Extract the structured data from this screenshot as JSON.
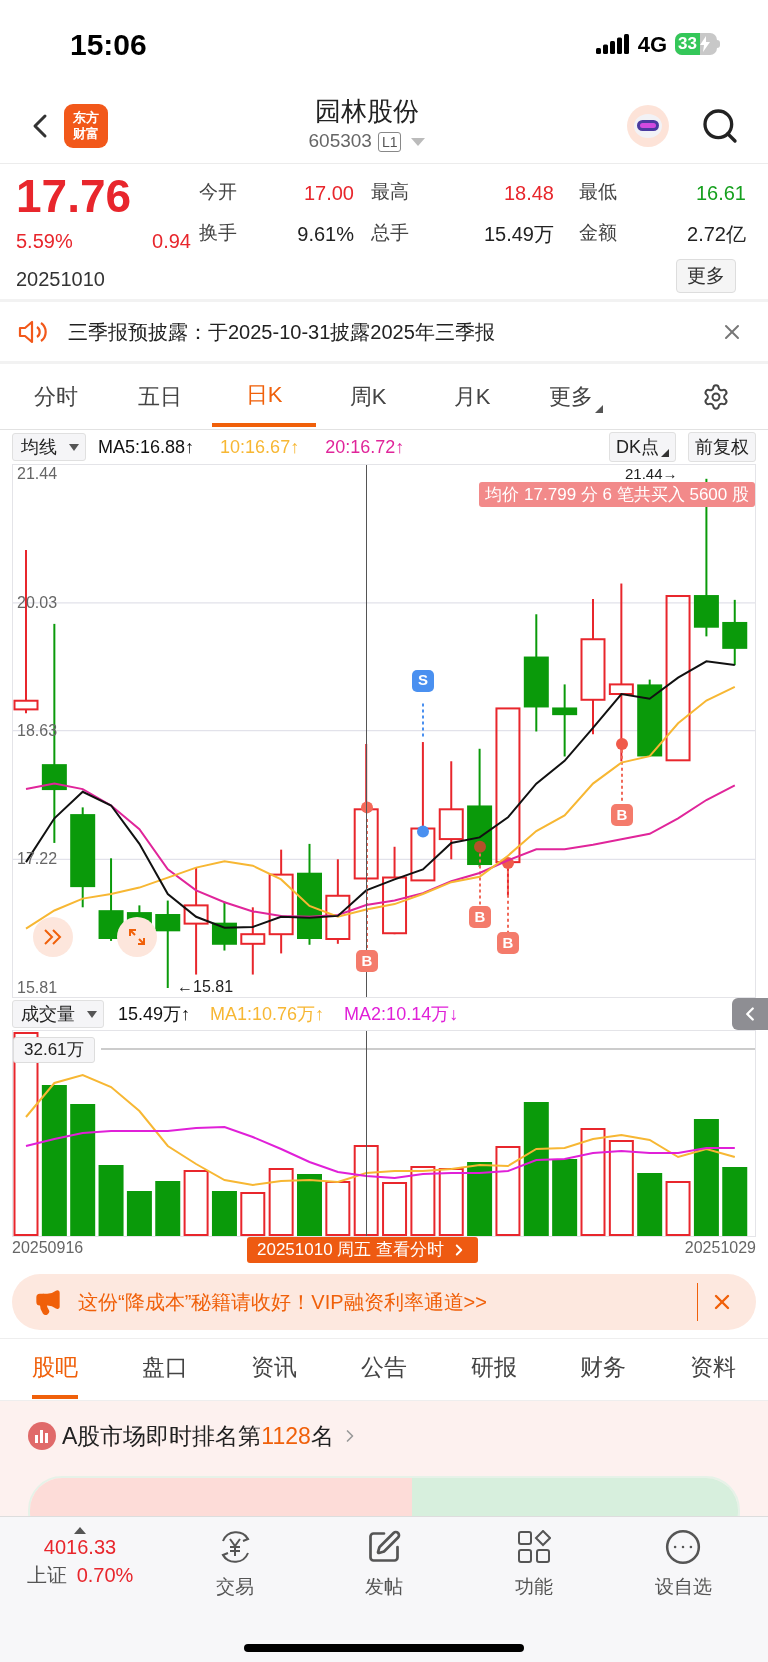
{
  "status_bar": {
    "time": "15:06",
    "network": "4G",
    "battery": "33"
  },
  "header": {
    "logo": [
      "东方",
      "财富"
    ],
    "title": "园林股份",
    "code": "605303",
    "level_badge": "L1"
  },
  "quote": {
    "price": "17.76",
    "change_pct": "5.59%",
    "change": "0.94",
    "date": "20251010",
    "more_button": "更多",
    "stats": [
      {
        "label": "今开",
        "value": "17.00",
        "color": "#e8262c"
      },
      {
        "label": "最高",
        "value": "18.48",
        "color": "#e8262c"
      },
      {
        "label": "最低",
        "value": "16.61",
        "color": "#16a01e"
      },
      {
        "label": "换手",
        "value": "9.61%",
        "color": "#222222"
      },
      {
        "label": "总手",
        "value": "15.49万",
        "color": "#222222"
      },
      {
        "label": "金额",
        "value": "2.72亿",
        "color": "#222222"
      }
    ]
  },
  "notice": {
    "text": "三季报预披露：于2025-10-31披露2025年三季报"
  },
  "chart_tabs": [
    {
      "label": "分时",
      "selected": false,
      "kind": "tab"
    },
    {
      "label": "五日",
      "selected": false,
      "kind": "tab"
    },
    {
      "label": "日K",
      "selected": true,
      "kind": "tab"
    },
    {
      "label": "周K",
      "selected": false,
      "kind": "tab"
    },
    {
      "label": "月K",
      "selected": false,
      "kind": "tab"
    },
    {
      "label": "更多",
      "selected": false,
      "kind": "dropdown"
    }
  ],
  "kline": {
    "indicator_select": "均线",
    "dk_button": "DK点",
    "adjust_button": "前复权",
    "ma_values": [
      {
        "text": ":16.88↑",
        "color": "#111111"
      },
      {
        "text": ":16.67↑",
        "color": "#f7b733"
      },
      {
        "text": ":16.72↑",
        "color": "#e0259a"
      }
    ],
    "chart_data": {
      "type": "line",
      "grid": true,
      "ylim": [
        15.69,
        21.54
      ],
      "yticks": [
        {
          "value": 21.44,
          "label": "21.44"
        },
        {
          "value": 20.03,
          "label": "20.03"
        },
        {
          "value": 18.63,
          "label": "18.63"
        },
        {
          "value": 17.22,
          "label": "17.22"
        },
        {
          "value": 15.81,
          "label": "15.81"
        }
      ],
      "series": [
        {
          "name": "MA5",
          "color": "#111111",
          "values": [
            17.19,
            17.67,
            17.96,
            17.81,
            17.39,
            16.84,
            16.59,
            16.47,
            16.48,
            16.59,
            16.58,
            16.6,
            16.88,
            17.0,
            17.11,
            17.4,
            17.46,
            17.68,
            18.05,
            18.3,
            18.66,
            19.03,
            18.98,
            19.21,
            19.39,
            19.35
          ]
        },
        {
          "name": "10",
          "color": "#f7b733",
          "values": [
            16.46,
            16.66,
            16.79,
            16.84,
            16.91,
            17.02,
            17.13,
            17.2,
            17.15,
            17.0,
            16.71,
            16.59,
            16.67,
            16.73,
            16.84,
            16.97,
            17.03,
            17.26,
            17.53,
            17.7,
            18.05,
            18.28,
            18.35,
            18.71,
            18.96,
            19.11
          ]
        },
        {
          "name": "20",
          "color": "#e0259a",
          "values": [
            17.99,
            18.05,
            17.99,
            17.81,
            17.55,
            17.11,
            16.88,
            16.75,
            16.65,
            16.6,
            16.59,
            16.61,
            16.72,
            16.77,
            16.85,
            16.98,
            17.07,
            17.21,
            17.33,
            17.33,
            17.38,
            17.44,
            17.5,
            17.67,
            17.87,
            18.03
          ]
        }
      ]
    },
    "high_marker": "21.44→",
    "low_marker": "←15.81",
    "trade_banner": "均价 17.799 分 6 笔共买入 5600 股",
    "signal_markers": [
      {
        "kind": "buy",
        "label": "B"
      },
      {
        "kind": "sell",
        "label": "S"
      },
      {
        "kind": "buy",
        "label": "B"
      },
      {
        "kind": "buy",
        "label": "B"
      },
      {
        "kind": "buy",
        "label": "B"
      }
    ]
  },
  "volume": {
    "indicator_select": "成交量",
    "max_label": "32.61万",
    "start_date": "20250916",
    "end_date": "20251029",
    "cursor_label": "20251010 周五 查看分时",
    "values": [
      {
        "text": "15.49万↑",
        "color": "#111111"
      },
      {
        "text": "MA1:10.76万↑",
        "color": "#f7b733"
      },
      {
        "text": "MA2:10.14万↓",
        "color": "#e020d8"
      }
    ]
  },
  "ad_banner": {
    "text": "这份“降成本”秘籍请收好！VIP融资利率通道>>"
  },
  "info_tabs": [
    {
      "label": "股吧",
      "selected": true
    },
    {
      "label": "盘口",
      "selected": false
    },
    {
      "label": "资讯",
      "selected": false
    },
    {
      "label": "公告",
      "selected": false
    },
    {
      "label": "研报",
      "selected": false
    },
    {
      "label": "财务",
      "selected": false
    },
    {
      "label": "资料",
      "selected": false
    }
  ],
  "rank": {
    "prefix": "A股市场即时排名第",
    "number": "1128",
    "suffix": "名"
  },
  "bottom_nav": {
    "index": {
      "value": "4016.33",
      "name": "上证",
      "change": "0.70%"
    },
    "items": [
      {
        "kind": "trade",
        "label": "交易"
      },
      {
        "kind": "post",
        "label": "发帖"
      },
      {
        "kind": "apps",
        "label": "功能"
      },
      {
        "kind": "watch",
        "label": "设自选"
      }
    ]
  }
}
